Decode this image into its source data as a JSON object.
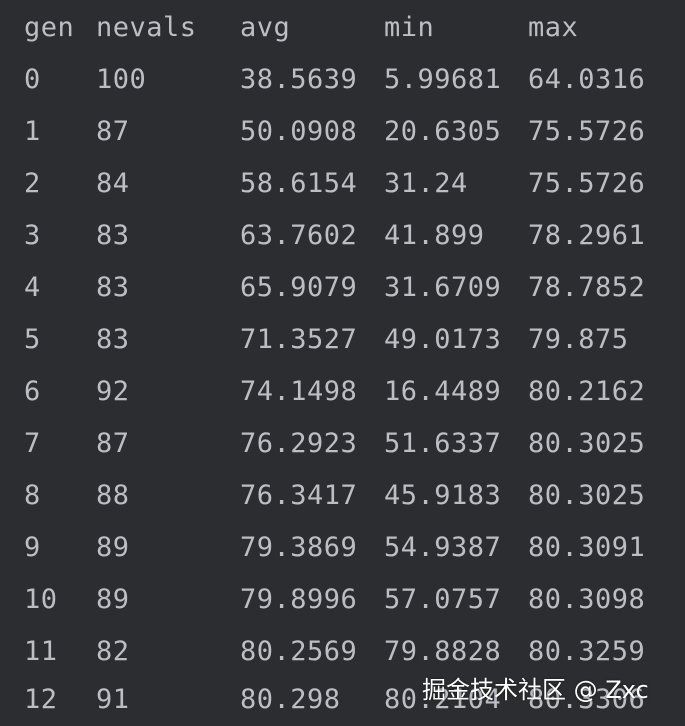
{
  "table": {
    "headers": [
      "gen",
      "nevals",
      "avg",
      "min",
      "max"
    ],
    "rows": [
      [
        "0",
        "100",
        "38.5639",
        "5.99681",
        "64.0316"
      ],
      [
        "1",
        "87",
        "50.0908",
        "20.6305",
        "75.5726"
      ],
      [
        "2",
        "84",
        "58.6154",
        "31.24",
        "75.5726"
      ],
      [
        "3",
        "83",
        "63.7602",
        "41.899",
        "78.2961"
      ],
      [
        "4",
        "83",
        "65.9079",
        "31.6709",
        "78.7852"
      ],
      [
        "5",
        "83",
        "71.3527",
        "49.0173",
        "79.875"
      ],
      [
        "6",
        "92",
        "74.1498",
        "16.4489",
        "80.2162"
      ],
      [
        "7",
        "87",
        "76.2923",
        "51.6337",
        "80.3025"
      ],
      [
        "8",
        "88",
        "76.3417",
        "45.9183",
        "80.3025"
      ],
      [
        "9",
        "89",
        "79.3869",
        "54.9387",
        "80.3091"
      ],
      [
        "10",
        "89",
        "79.8996",
        "57.0757",
        "80.3098"
      ],
      [
        "11",
        "82",
        "80.2569",
        "79.8828",
        "80.3259"
      ],
      [
        "12",
        "91",
        "80.298",
        "80.2104",
        "80.3306"
      ]
    ]
  },
  "watermark": "掘金技术社区 @ Zxc",
  "colors": {
    "background": "#2b2d30",
    "text": "#bcbec4",
    "watermark": "#ffffff"
  }
}
